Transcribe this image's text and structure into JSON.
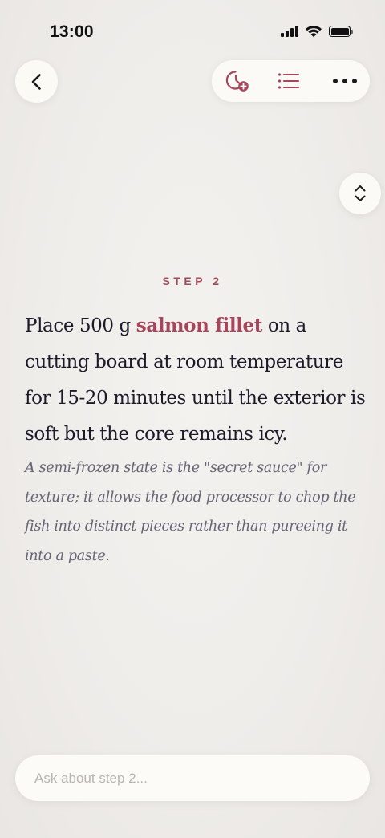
{
  "status_bar": {
    "time": "13:00",
    "icons": [
      "signal-icon",
      "wifi-icon",
      "battery-icon"
    ]
  },
  "header": {
    "back_icon": "chevron-left-icon",
    "toolbar_icons": [
      "timer-add-icon",
      "list-icon",
      "more-icon"
    ]
  },
  "step": {
    "label": "STEP 2",
    "instruction_before": "Place 500 g ",
    "ingredient": "salmon fillet",
    "instruction_after": " on a cutting board at room temperature for 15-20 minutes until the exterior is soft but the core remains icy.",
    "note": "A semi-frozen state is the \"secret sauce\" for texture; it allows the food processor to chop the fish into distinct pieces rather than pureeing it into a paste."
  },
  "ask": {
    "placeholder": "Ask about step 2..."
  },
  "colors": {
    "accent": "#a8455b",
    "text": "#1b1a2a",
    "note": "#646474",
    "background": "#efedea"
  }
}
